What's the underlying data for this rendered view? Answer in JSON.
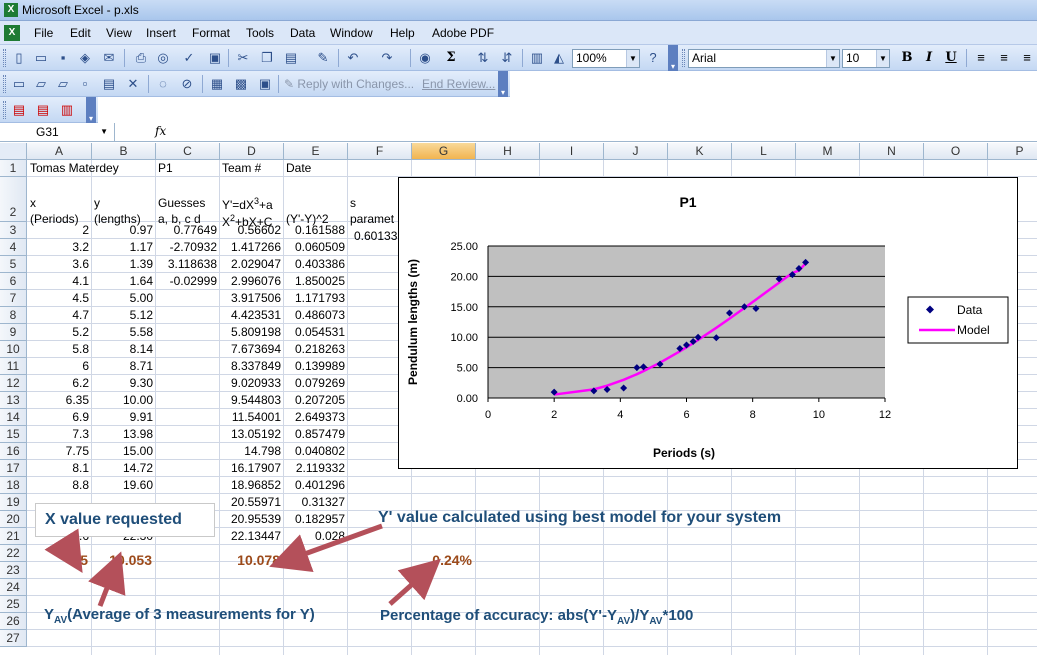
{
  "window": {
    "title": "Microsoft Excel - p.xls"
  },
  "menu": [
    "File",
    "Edit",
    "View",
    "Insert",
    "Format",
    "Tools",
    "Data",
    "Window",
    "Help",
    "Adobe PDF"
  ],
  "toolbar": {
    "zoom": "100%",
    "font": "Arial",
    "font_size": "10",
    "bold": "B",
    "italic": "I",
    "underline": "U",
    "sigma": "Σ",
    "reply_with_changes": "Reply with Changes...",
    "end_review": "End Review..."
  },
  "formula_bar": {
    "name_box": "G31",
    "fx": "fx",
    "formula": ""
  },
  "columns": [
    "A",
    "B",
    "C",
    "D",
    "E",
    "F",
    "G",
    "H",
    "I",
    "J",
    "K",
    "L",
    "M",
    "N",
    "O",
    "P"
  ],
  "selected_column": "G",
  "rows": [
    "1",
    "2",
    "3",
    "4",
    "5",
    "6",
    "7",
    "8",
    "9",
    "10",
    "11",
    "12",
    "13",
    "14",
    "15",
    "16",
    "17",
    "18",
    "19",
    "20",
    "21",
    "22",
    "23",
    "24",
    "25",
    "26",
    "27"
  ],
  "headers": {
    "a1": "Tomas Materdey",
    "c1": "P1",
    "d1": "Team #",
    "e1": "Date",
    "a2_1": "x",
    "a2_2": "(Periods)",
    "b2_1": "y",
    "b2_2": "(lengths)",
    "c2_1": "Guesses",
    "c2_2": "a, b, c d",
    "d2_1a": "Y'=dX",
    "d2_1b": "3",
    "d2_1c": "+a",
    "d2_2a": "X",
    "d2_2b": "2",
    "d2_2c": "+bX+C",
    "e2": "(Y'-Y)^2",
    "f2_1": "s",
    "f2_2": "paramet",
    "f3": "0.60133"
  },
  "table": {
    "x": [
      "2",
      "3.2",
      "3.6",
      "4.1",
      "4.5",
      "4.7",
      "5.2",
      "5.8",
      "6",
      "6.2",
      "6.35",
      "6.9",
      "7.3",
      "7.75",
      "8.1",
      "8.8",
      "",
      "",
      "9.6"
    ],
    "y": [
      "0.97",
      "1.17",
      "1.39",
      "1.64",
      "5.00",
      "5.12",
      "5.58",
      "8.14",
      "8.71",
      "9.30",
      "10.00",
      "9.91",
      "13.98",
      "15.00",
      "14.72",
      "19.60",
      "",
      "",
      "22.30"
    ],
    "guesses": [
      "0.77649",
      "-2.70932",
      "3.118638",
      "-0.02999"
    ],
    "yprime": [
      "0.56602",
      "1.417266",
      "2.029047",
      "2.996076",
      "3.917506",
      "4.423531",
      "5.809198",
      "7.673694",
      "8.337849",
      "9.020933",
      "9.544803",
      "11.54001",
      "13.05192",
      "14.798",
      "16.17907",
      "18.96852",
      "20.55971",
      "20.95539",
      "22.13447"
    ],
    "sq": [
      "0.161588",
      "0.060509",
      "0.403386",
      "1.850025",
      "1.171793",
      "0.486073",
      "0.054531",
      "0.218263",
      "0.139989",
      "0.079269",
      "0.207205",
      "2.649373",
      "0.857479",
      "0.040802",
      "2.119332",
      "0.401296",
      "0.31327",
      "0.182957",
      "0.028"
    ]
  },
  "row22": {
    "a": "6.5",
    "b": "10.053",
    "d": "10.078",
    "g": "0.24%"
  },
  "annotations": {
    "x_requested": "X value requested",
    "yprime_calc": "Y' value calculated using best model for your system",
    "yav_sub": "AV",
    "yav_text": "(Average of 3 measurements for Y)",
    "accuracy_a": "Percentage of accuracy: abs(Y'-Y",
    "accuracy_b": ")/Y",
    "accuracy_c": "*100"
  },
  "colors": {
    "annotation_blue": "#1f4e79",
    "annotation_red": "#9c4a1a",
    "model_line": "#ff00ff",
    "plot_area": "#c0c0c0",
    "arrow": "#b4505a"
  },
  "chart_data": {
    "type": "scatter",
    "title": "P1",
    "xlabel": "Periods (s)",
    "ylabel": "Pendulum lengths (m)",
    "xlim": [
      0,
      12
    ],
    "ylim": [
      0,
      25
    ],
    "xticks": [
      "0",
      "2",
      "4",
      "6",
      "8",
      "10",
      "12"
    ],
    "yticks": [
      "0.00",
      "5.00",
      "10.00",
      "15.00",
      "20.00",
      "25.00"
    ],
    "grid": "horizontal",
    "legend_position": "right",
    "series": [
      {
        "name": "Data",
        "kind": "points",
        "x": [
          2,
          3.2,
          3.6,
          4.1,
          4.5,
          4.7,
          5.2,
          5.8,
          6,
          6.2,
          6.35,
          6.9,
          7.3,
          7.75,
          8.1,
          8.8,
          9.2,
          9.4,
          9.6
        ],
        "y": [
          0.97,
          1.17,
          1.39,
          1.64,
          5.0,
          5.12,
          5.58,
          8.14,
          8.71,
          9.3,
          10.0,
          9.91,
          13.98,
          15.0,
          14.72,
          19.6,
          20.3,
          21.3,
          22.3
        ]
      },
      {
        "name": "Model",
        "kind": "line",
        "x": [
          2,
          3.2,
          3.6,
          4.1,
          4.5,
          4.7,
          5.2,
          5.8,
          6,
          6.2,
          6.35,
          6.9,
          7.3,
          7.75,
          8.1,
          8.8,
          9.2,
          9.4,
          9.6
        ],
        "y": [
          0.566,
          1.417,
          2.029,
          2.996,
          3.918,
          4.424,
          5.809,
          7.674,
          8.338,
          9.021,
          9.545,
          11.54,
          13.052,
          14.798,
          16.179,
          18.969,
          20.56,
          20.955,
          22.134
        ]
      }
    ]
  }
}
